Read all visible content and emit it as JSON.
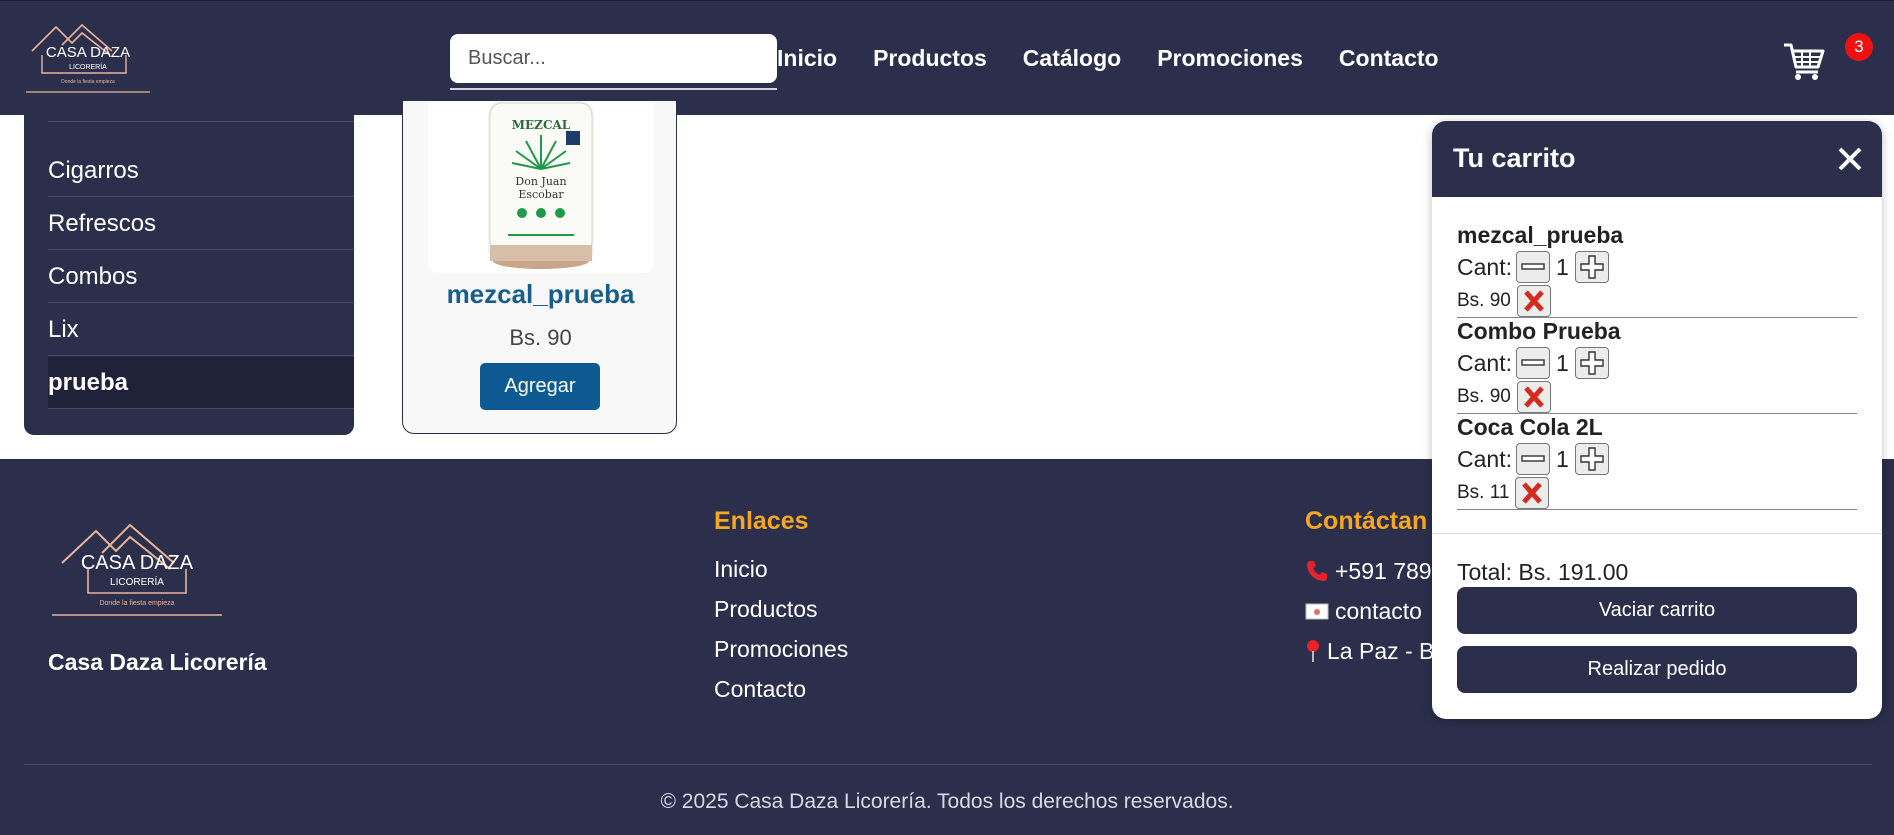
{
  "header": {
    "logo": {
      "line1": "CASA DAZA",
      "line2": "LICORERÍA",
      "tagline": "Donde la fiesta empieza"
    },
    "search": {
      "placeholder": "Buscar...",
      "value": ""
    },
    "nav": [
      "Inicio",
      "Productos",
      "Catálogo",
      "Promociones",
      "Contacto"
    ],
    "cart": {
      "icon": "cart-icon",
      "count": "3",
      "badge_color": "#ee1111"
    }
  },
  "sidebar": {
    "items": [
      "Cigarros",
      "Refrescos",
      "Combos",
      "Lix",
      "prueba"
    ],
    "active": "prueba"
  },
  "product": {
    "name": "mezcal_prueba",
    "price": "Bs. 90",
    "add_label": "Agregar",
    "image_label": {
      "brand": "MEZCAL",
      "line1": "Don Juan",
      "line2": "Escobar"
    }
  },
  "footer": {
    "logo": {
      "line1": "CASA DAZA",
      "line2": "LICORERÍA",
      "tagline": "Donde la fiesta empieza"
    },
    "brand": "Casa Daza Licorería",
    "links_title": "Enlaces",
    "links": [
      "Inicio",
      "Productos",
      "Promociones",
      "Contacto"
    ],
    "contact_title": "Contáctan",
    "contacts": [
      {
        "icon": "phone-icon",
        "text": "+591 789"
      },
      {
        "icon": "envelope-icon",
        "text": "contacto"
      },
      {
        "icon": "pin-icon",
        "text": "La Paz - B"
      }
    ],
    "copyright": "© 2025 Casa Daza Licorería. Todos los derechos reservados."
  },
  "cart_panel": {
    "title": "Tu carrito",
    "qty_label": "Cant:",
    "items": [
      {
        "name": "mezcal_prueba",
        "qty": "1",
        "price": "Bs. 90"
      },
      {
        "name": "Combo Prueba",
        "qty": "1",
        "price": "Bs. 90"
      },
      {
        "name": "Coca Cola 2L",
        "qty": "1",
        "price": "Bs. 11"
      }
    ],
    "total": "Total: Bs. 191.00",
    "clear_label": "Vaciar carrito",
    "order_label": "Realizar pedido"
  },
  "colors": {
    "navy": "#2b2f4b",
    "accent_orange": "#f5a623",
    "product_blue": "#175e8f",
    "button_blue": "#0d5a92"
  }
}
